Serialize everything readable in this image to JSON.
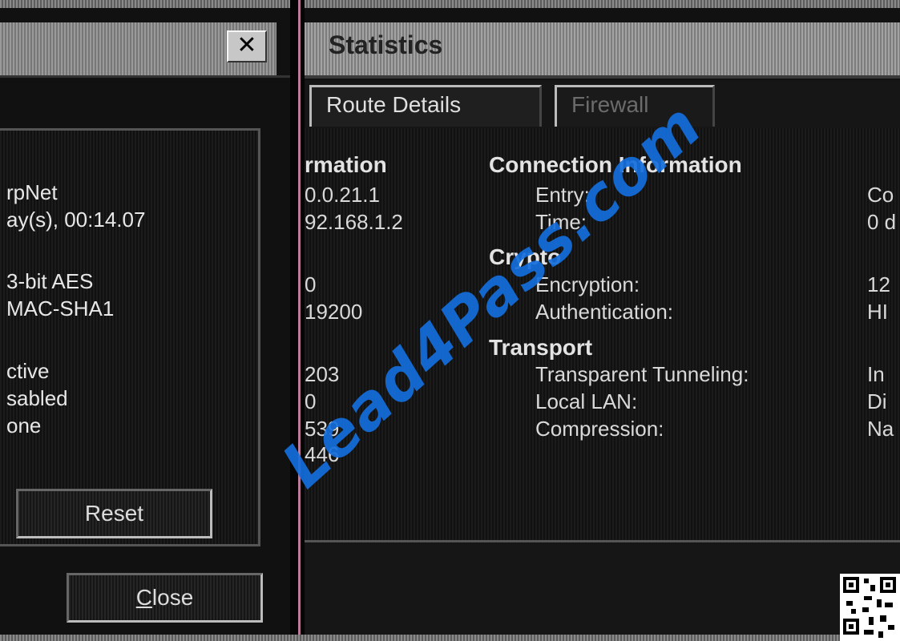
{
  "left_dialog": {
    "close_glyph": "✕",
    "lines": [
      "rpNet",
      "ay(s), 00:14.07",
      "3-bit AES",
      "MAC-SHA1",
      "ctive",
      "sabled",
      "one"
    ],
    "reset_label": "Reset",
    "close_mnemonic": "C",
    "close_rest": "lose"
  },
  "statistics_window": {
    "title": "Statistics",
    "tabs": [
      {
        "label": "Route Details",
        "enabled": true
      },
      {
        "label": "Firewall",
        "enabled": false
      }
    ],
    "left_column": {
      "heading": "rmation",
      "values": [
        "0.0.21.1",
        "92.168.1.2",
        "0",
        "19200",
        "203",
        "0",
        "539",
        "446"
      ]
    },
    "connection": {
      "heading": "Connection Information",
      "rows": [
        {
          "label": "Entry:",
          "value": "Co"
        },
        {
          "label": "Time:",
          "value": "0 d"
        }
      ]
    },
    "crypto": {
      "heading": "Crypto",
      "rows": [
        {
          "label": "Encryption:",
          "value": "12"
        },
        {
          "label": "Authentication:",
          "value": "HI"
        }
      ]
    },
    "transport": {
      "heading": "Transport",
      "rows": [
        {
          "label": "Transparent Tunneling:",
          "value": "In"
        },
        {
          "label": "Local LAN:",
          "value": "Di"
        },
        {
          "label": "Compression:",
          "value": "Na"
        }
      ]
    }
  },
  "watermark": "Lead4Pass.com",
  "colors": {
    "watermark": "#146edc",
    "divider_line": "#b97b97",
    "titlebar": "#9a9a9a",
    "background": "#111111"
  }
}
